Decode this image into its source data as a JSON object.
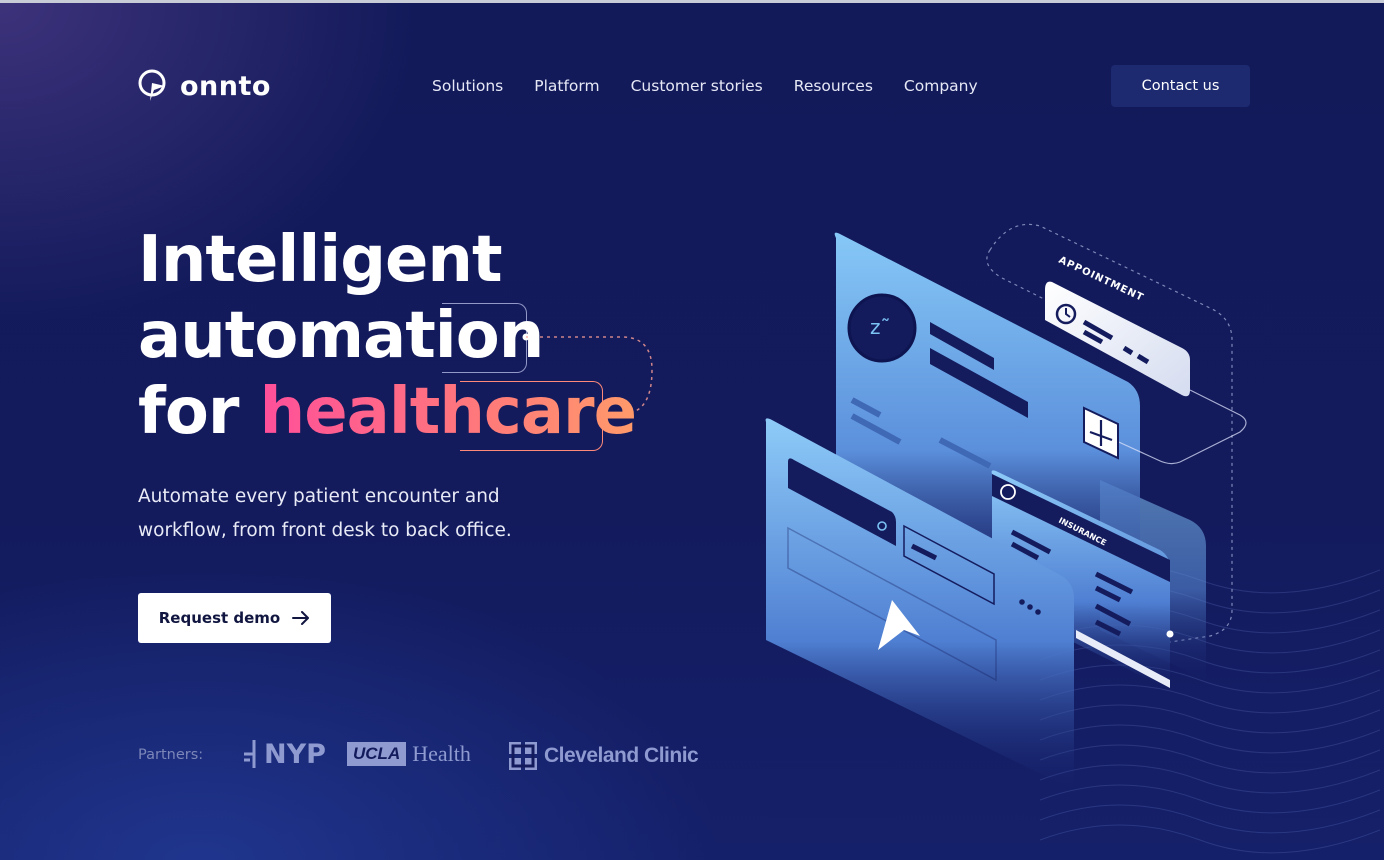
{
  "header": {
    "brand": "onnto",
    "nav": [
      "Solutions",
      "Platform",
      "Customer stories",
      "Resources",
      "Company"
    ],
    "contact_label": "Contact us"
  },
  "hero": {
    "headline": {
      "line1": "Intelligent",
      "line2": "automation",
      "line3_prefix": "for ",
      "line3_accent": "healthcare"
    },
    "subtext": "Automate every patient encounter and workflow, from front desk to back office.",
    "demo_label": "Request demo"
  },
  "illustration": {
    "appointment_label": "APPOINTMENT",
    "insurance_label": "INSURANCE",
    "sleep_glyph": "z˜"
  },
  "partners": {
    "label": "Partners:",
    "nyp": "NYP",
    "ucla_box": "UCLA",
    "ucla_word": "Health",
    "cleveland": "Cleveland Clinic"
  },
  "colors": {
    "background": "#131b5c",
    "accent_start": "#ff4f9a",
    "accent_end": "#ff9a6a",
    "card_blue": "#7cc3f5",
    "partner_gray": "#8f9ad0"
  }
}
